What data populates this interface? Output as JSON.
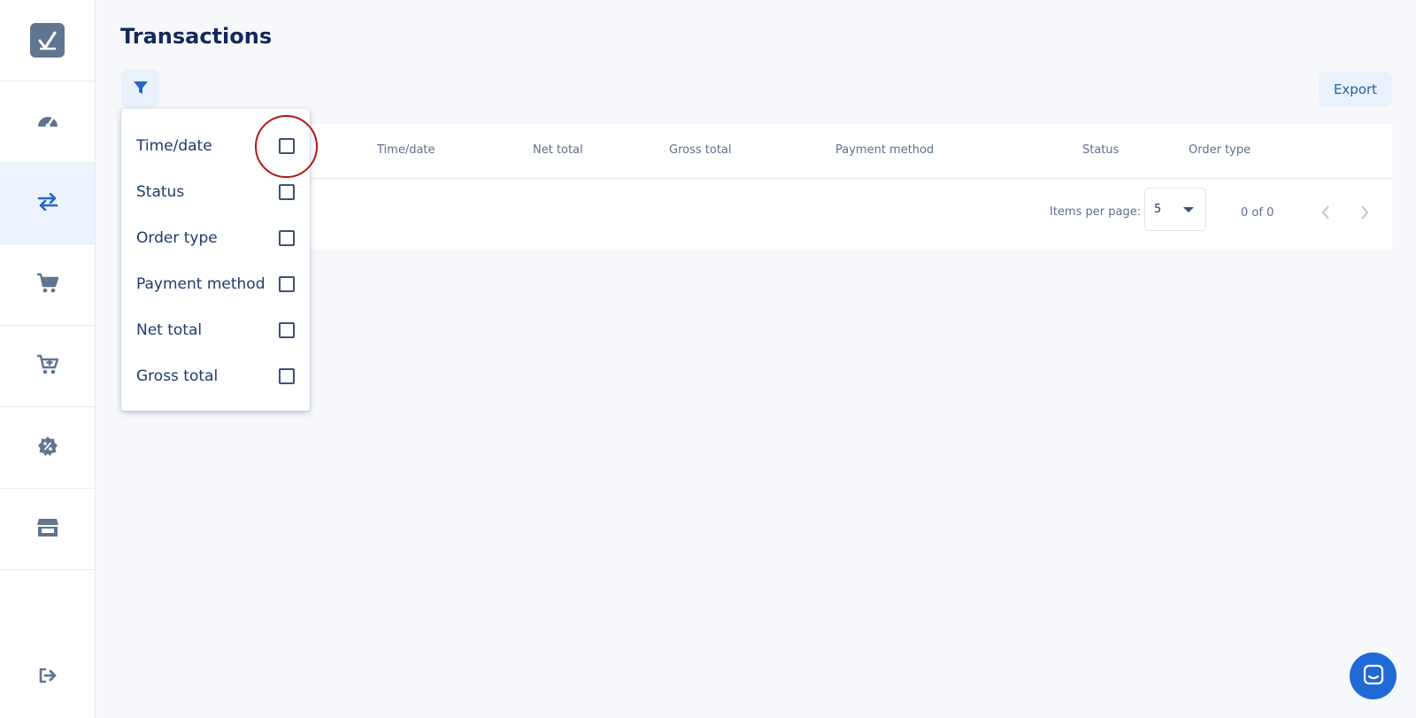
{
  "page": {
    "title": "Transactions"
  },
  "sidebar": {
    "items": [
      {
        "icon": "dashboard-gauge-icon"
      },
      {
        "icon": "transactions-arrows-icon",
        "active": true
      },
      {
        "icon": "cart-icon"
      },
      {
        "icon": "cart-add-icon"
      },
      {
        "icon": "discount-badge-icon"
      },
      {
        "icon": "store-icon"
      }
    ],
    "logout_icon": "logout-icon"
  },
  "toolbar": {
    "filter_icon": "filter-icon",
    "export_label": "Export"
  },
  "table": {
    "columns": [
      "Time/date",
      "Net total",
      "Gross total",
      "Payment method",
      "Status",
      "Order type"
    ],
    "rows": []
  },
  "pagination": {
    "items_per_page_label": "Items per page:",
    "items_per_page_value": "5",
    "range_label": "0 of 0"
  },
  "column_menu": {
    "items": [
      {
        "label": "Time/date",
        "checked": false
      },
      {
        "label": "Status",
        "checked": false
      },
      {
        "label": "Order type",
        "checked": false
      },
      {
        "label": "Payment method",
        "checked": false
      },
      {
        "label": "Net total",
        "checked": false
      },
      {
        "label": "Gross total",
        "checked": false
      }
    ]
  },
  "colors": {
    "accent": "#1f6ad6",
    "highlight_ring": "#b51616",
    "sidebar_active_bg": "#edf3fc"
  }
}
